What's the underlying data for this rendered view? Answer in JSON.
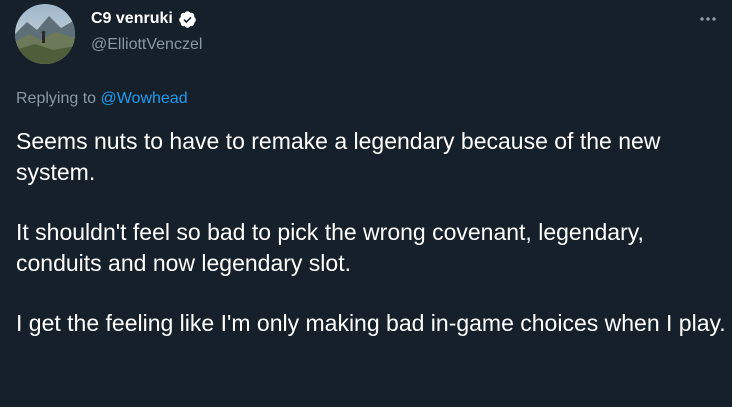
{
  "author": {
    "display_name": "C9 venruki",
    "handle": "@ElliottVenczel",
    "verified": true,
    "avatar": "mountain-landscape-avatar"
  },
  "reply": {
    "prefix": "Replying to ",
    "mention": "@Wowhead"
  },
  "tweet": {
    "paragraphs": [
      "Seems nuts to have to remake a legendary because of the new system.",
      "It shouldn't feel so bad to pick the wrong covenant, legendary, conduits and now legendary slot.",
      "I get the feeling like I'm only making bad in-game choices when I play."
    ]
  },
  "icons": {
    "verified": "verified-badge-icon",
    "more": "more-options-icon"
  },
  "colors": {
    "background": "#15202b",
    "text_primary": "#ffffff",
    "text_secondary": "#8b98a5",
    "accent": "#1d9bf0"
  }
}
